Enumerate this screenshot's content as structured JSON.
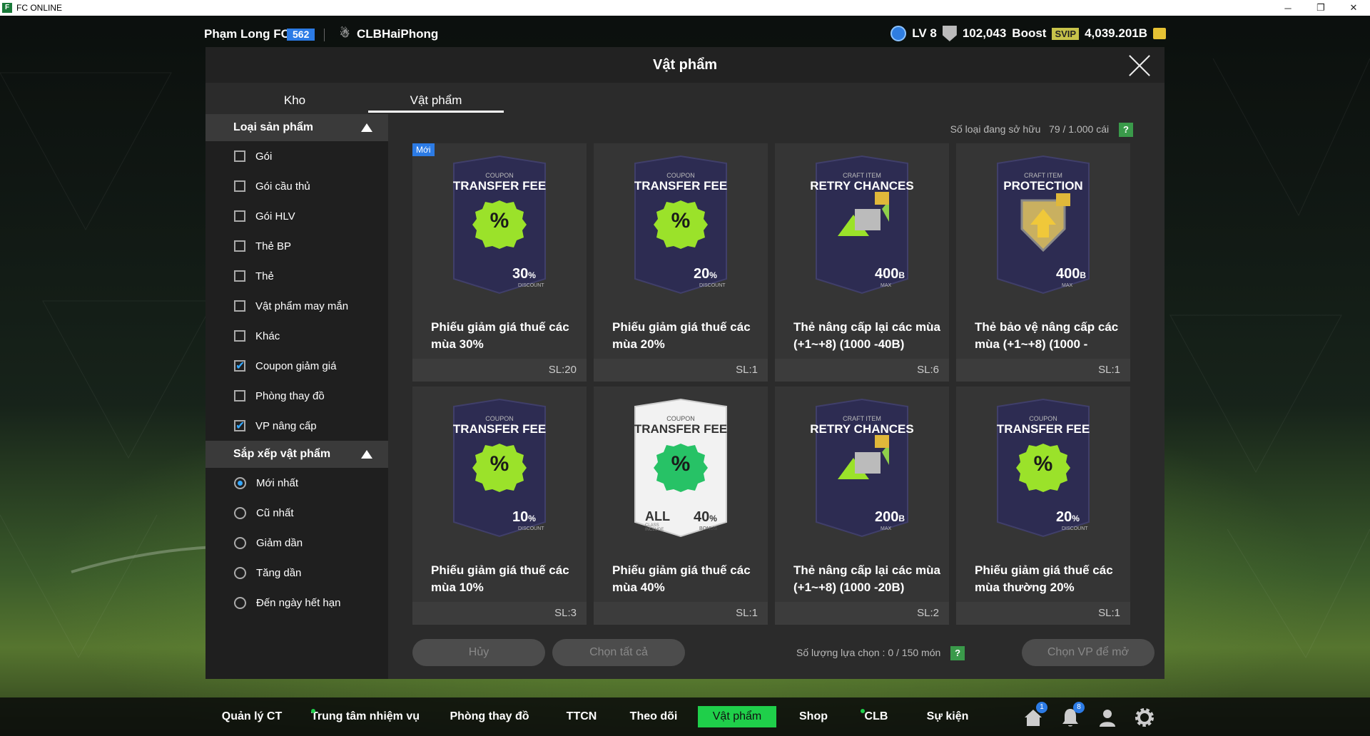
{
  "window": {
    "title": "FC ONLINE",
    "logo": "F"
  },
  "header": {
    "player_name": "Phạm Long FCO",
    "player_level": "562",
    "club_name": "CLBHaiPhong",
    "level": "LV 8",
    "trophies": "102,043",
    "boost_label": "Boost",
    "svip": "SVIP",
    "balance": "4,039.201B"
  },
  "panel": {
    "title": "Vật phẩm",
    "tabs": [
      "Kho",
      "Vật phẩm"
    ],
    "owned_label": "Số loại đang sở hữu",
    "owned_value": "79 / 1.000 cái"
  },
  "filters": {
    "product_type_title": "Loại sản phẩm",
    "product_types": [
      {
        "label": "Gói",
        "checked": false
      },
      {
        "label": "Gói cầu thủ",
        "checked": false
      },
      {
        "label": "Gói HLV",
        "checked": false
      },
      {
        "label": "Thẻ BP",
        "checked": false
      },
      {
        "label": "Thẻ",
        "checked": false
      },
      {
        "label": "Vật phẩm may mắn",
        "checked": false
      },
      {
        "label": "Khác",
        "checked": false
      },
      {
        "label": "Coupon giảm giá",
        "checked": true
      },
      {
        "label": "Phòng thay đồ",
        "checked": false
      },
      {
        "label": "VP nâng cấp",
        "checked": true
      }
    ],
    "sort_title": "Sắp xếp vật phẩm",
    "sort_options": [
      {
        "label": "Mới nhất",
        "selected": true
      },
      {
        "label": "Cũ nhất",
        "selected": false
      },
      {
        "label": "Giảm dần",
        "selected": false
      },
      {
        "label": "Tăng dần",
        "selected": false
      },
      {
        "label": "Đến ngày hết hạn",
        "selected": false
      }
    ]
  },
  "items": [
    {
      "new_label": "Mới",
      "top": "COUPON",
      "title": "TRANSFER FEE",
      "value": "30",
      "unit": "%",
      "sub": "DISCOUNT",
      "name": "Phiếu giảm giá thuế các mùa 30%",
      "qty": "SL:20",
      "kind": "coupon"
    },
    {
      "new_label": "",
      "top": "COUPON",
      "title": "TRANSFER FEE",
      "value": "20",
      "unit": "%",
      "sub": "DISCOUNT",
      "name": "Phiếu giảm giá thuế các mùa 20%",
      "qty": "SL:1",
      "kind": "coupon"
    },
    {
      "new_label": "",
      "top": "CRAFT ITEM",
      "title": "RETRY CHANCES",
      "value": "400",
      "unit": "B",
      "sub": "MAX",
      "name": "Thẻ nâng cấp lại các mùa (+1~+8) (1000 -40B)",
      "qty": "SL:6",
      "kind": "retry"
    },
    {
      "new_label": "",
      "top": "CRAFT ITEM",
      "title": "PROTECTION",
      "value": "400",
      "unit": "B",
      "sub": "MAX",
      "name": "Thẻ bảo vệ nâng cấp các mùa (+1~+8) (1000 -",
      "qty": "SL:1",
      "kind": "protect"
    },
    {
      "new_label": "",
      "top": "COUPON",
      "title": "TRANSFER FEE",
      "value": "10",
      "unit": "%",
      "sub": "DISCOUNT",
      "name": "Phiếu giảm giá thuế các mùa 10%",
      "qty": "SL:3",
      "kind": "coupon"
    },
    {
      "new_label": "",
      "top": "COUPON",
      "title": "TRANSFER FEE",
      "value": "40",
      "unit": "%",
      "sub": "BONUS",
      "name": "Phiếu giảm giá thuế các mùa 40%",
      "qty": "SL:1",
      "kind": "white",
      "all": "ALL",
      "all_sub": "CLASS INCLUDE"
    },
    {
      "new_label": "",
      "top": "CRAFT ITEM",
      "title": "RETRY CHANCES",
      "value": "200",
      "unit": "B",
      "sub": "MAX",
      "name": "Thẻ nâng cấp lại các mùa (+1~+8) (1000 -20B)",
      "qty": "SL:2",
      "kind": "retry"
    },
    {
      "new_label": "",
      "top": "COUPON",
      "title": "TRANSFER FEE",
      "value": "20",
      "unit": "%",
      "sub": "DISCOUNT",
      "name": "Phiếu giảm giá thuế các mùa thường 20%",
      "qty": "SL:1",
      "kind": "coupon"
    }
  ],
  "actions": {
    "cancel": "Hủy",
    "select_all": "Chọn tất cả",
    "selection_count": "Số lượng lựa chọn : 0 / 150 món",
    "help": "?",
    "open": "Chọn VP để mở"
  },
  "bottom_nav": [
    "Quản lý CT",
    "Trung tâm nhiệm vụ",
    "Phòng thay đồ",
    "TTCN",
    "Theo dõi",
    "Vật phẩm",
    "Shop",
    "CLB",
    "Sự kiện"
  ],
  "notifications": {
    "home_badge": "1",
    "bell_badge": "8"
  },
  "colors": {
    "accent_green": "#1fcf4a",
    "badge_blue": "#2c7be5",
    "coupon_green": "#9be22a"
  }
}
